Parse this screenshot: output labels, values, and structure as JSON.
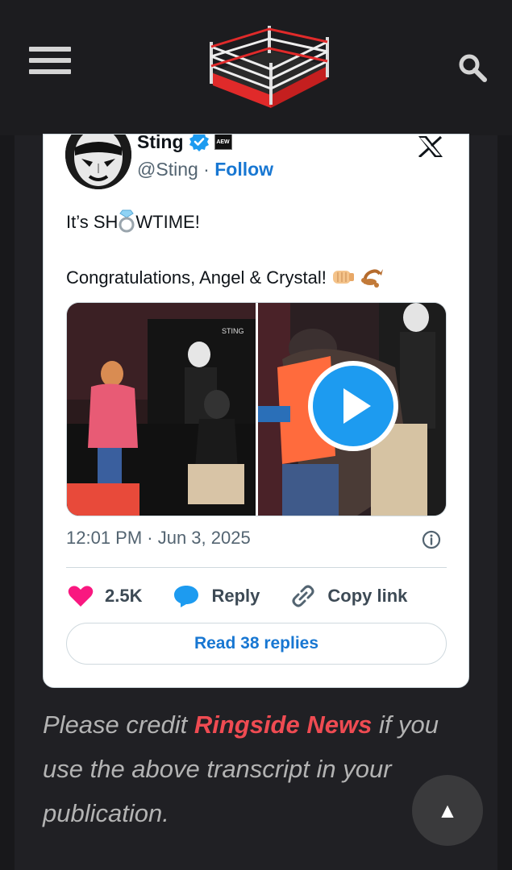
{
  "header": {
    "menu_icon": "hamburger-menu-icon",
    "logo_icon": "wrestling-ring-logo",
    "search_icon": "search-icon"
  },
  "tweet": {
    "display_name": "Sting",
    "handle": "@Sting",
    "separator": " · ",
    "follow_label": "Follow",
    "text_line1_before": "It’s SH",
    "text_line1_after": "WTIME!",
    "text_line2": "Congratulations, Angel & Crystal!",
    "timestamp": "12:01 PM · Jun 3, 2025",
    "like_count": "2.5K",
    "reply_label": "Reply",
    "copy_label": "Copy link",
    "read_replies_label": "Read 38 replies",
    "accent_color": "#1d9bf0",
    "like_color": "#f91880"
  },
  "credit": {
    "before": "Please credit ",
    "brand": "Ringside News",
    "after": " if you use the above transcript in your publication."
  },
  "scroll_top_icon": "arrow-up-icon",
  "scroll_top_label": "▲"
}
